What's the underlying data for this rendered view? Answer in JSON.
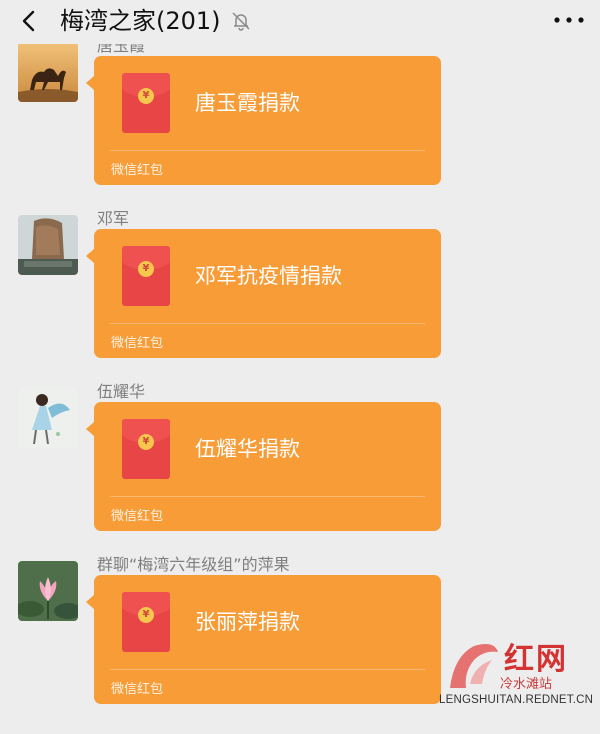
{
  "header": {
    "title": "梅湾之家(201)",
    "back_icon": "chevron-left-icon",
    "mute_icon": "bell-off-icon",
    "more_icon": "more-dots-icon"
  },
  "messages": [
    {
      "sender": "唐玉霞",
      "title": "唐玉霞捐款",
      "label": "微信红包"
    },
    {
      "sender": "邓军",
      "title": "邓军抗疫情捐款",
      "label": "微信红包"
    },
    {
      "sender": "伍耀华",
      "title": "伍耀华捐款",
      "label": "微信红包"
    },
    {
      "sender": "群聊“梅湾六年级组”的萍果",
      "title": "张丽萍捐款",
      "label": "微信红包"
    }
  ],
  "coin_symbol": "¥",
  "watermark": {
    "name": "红网",
    "sub": "冷水滩站",
    "url": "LENGSHUITAN.REDNET.CN"
  },
  "colors": {
    "background": "#ededed",
    "red_packet": "#f89c38",
    "envelope": "#e84646"
  }
}
